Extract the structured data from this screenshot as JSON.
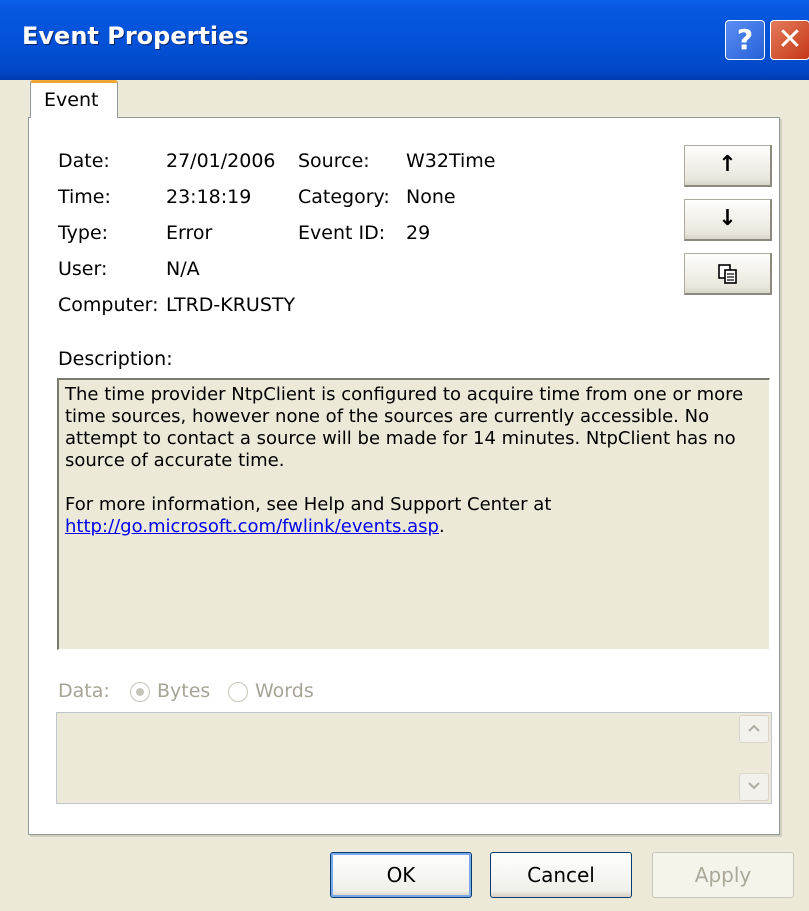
{
  "window": {
    "title": "Event Properties",
    "help_label": "?",
    "close_label": "✕",
    "accent_color": "#0352D8"
  },
  "tab": {
    "label": "Event"
  },
  "fields": {
    "date_label": "Date:",
    "date": "27/01/2006",
    "time_label": "Time:",
    "time": "23:18:19",
    "type_label": "Type:",
    "type": "Error",
    "user_label": "User:",
    "user": "N/A",
    "computer_label": "Computer:",
    "computer": "LTRD-KRUSTY",
    "source_label": "Source:",
    "source": "W32Time",
    "category_label": "Category:",
    "category": "None",
    "event_id_label": "Event ID:",
    "event_id": "29"
  },
  "nav": {
    "up_icon": "↑",
    "down_icon": "↓",
    "copy_icon": "copy-icon"
  },
  "description": {
    "label": "Description:",
    "paragraph1": "The time provider NtpClient is configured to acquire time from one or more time sources, however none of the sources are currently accessible.  No attempt to contact a source will be made for 14 minutes. NtpClient has no source of accurate time.",
    "paragraph2": "For more information, see Help and Support Center at",
    "link": "http://go.microsoft.com/fwlink/events.asp",
    "link_suffix": "."
  },
  "data": {
    "label": "Data:",
    "bytes_label": "Bytes",
    "words_label": "Words",
    "selected": "Bytes"
  },
  "buttons": {
    "ok": "OK",
    "cancel": "Cancel",
    "apply": "Apply"
  }
}
